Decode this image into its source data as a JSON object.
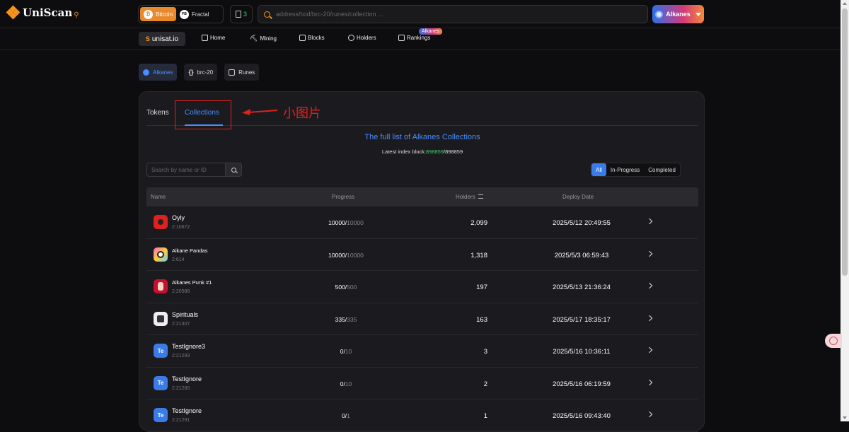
{
  "header": {
    "logo_text": "UniScan",
    "chains": [
      {
        "label": "Bitcoin",
        "active": true
      },
      {
        "label": "Fractal",
        "active": false
      }
    ],
    "gas_value": "3",
    "search_placeholder": "address/txid/brc-20/runes/collection ...",
    "protocol_label": "Alkanes"
  },
  "nav": {
    "site": "unisat.io",
    "items": [
      "Home",
      "Mining",
      "Blocks",
      "Holders",
      "Rankings"
    ],
    "rankings_badge": "Alkanes"
  },
  "protocol_tabs": [
    "Alkanes",
    "brc-20",
    "Runes"
  ],
  "card": {
    "tabs": [
      "Tokens",
      "Collections"
    ],
    "annotation": "小图片",
    "title": "The full list of Alkanes Collections",
    "index_label": "Latest index block:",
    "index_current": "898859",
    "index_total": "/898859",
    "search_placeholder": "Search by name or ID",
    "filters": [
      "All",
      "In-Progress",
      "Completed"
    ],
    "columns": [
      "Name",
      "Progress",
      "Holders",
      "Deploy Date"
    ],
    "rows": [
      {
        "name": "Oyly",
        "id": "2:10672",
        "minted": "10000/",
        "total": "10000",
        "holders": "2,099",
        "date": "2025/5/12 20:49:55"
      },
      {
        "name": "Alkane Pandas",
        "id": "2:614",
        "minted": "10000/",
        "total": "10000",
        "holders": "1,318",
        "date": "2025/5/3 06:59:43"
      },
      {
        "name": "Alkanes Punk #1",
        "id": "2:20588",
        "minted": "500/",
        "total": "500",
        "holders": "197",
        "date": "2025/5/13 21:36:24"
      },
      {
        "name": "Spirituals",
        "id": "2:21307",
        "minted": "335/",
        "total": "335",
        "holders": "163",
        "date": "2025/5/17 18:35:17"
      },
      {
        "name": "TestIgnore3",
        "id": "2:21293",
        "minted": "0/",
        "total": "10",
        "holders": "3",
        "date": "2025/5/16 10:36:11"
      },
      {
        "name": "TestIgnore",
        "id": "2:21280",
        "minted": "0/",
        "total": "10",
        "holders": "2",
        "date": "2025/5/16 06:19:59"
      },
      {
        "name": "TestIgnore",
        "id": "2:21291",
        "minted": "0/",
        "total": "1",
        "holders": "1",
        "date": "2025/5/16 09:43:40"
      }
    ],
    "avatar_text": "Te"
  },
  "colors": {
    "accent": "#4a8cff",
    "bitcoin": "#f7931a",
    "annotation": "#e0211c",
    "success": "#3fcf6f"
  }
}
